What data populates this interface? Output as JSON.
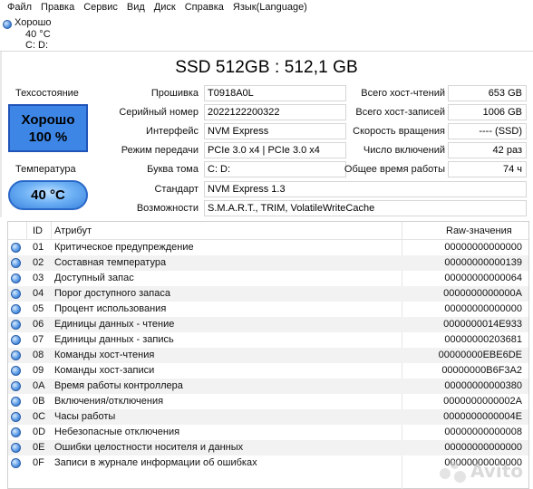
{
  "menu": [
    "Файл",
    "Правка",
    "Сервис",
    "Вид",
    "Диск",
    "Справка",
    "Язык(Language)"
  ],
  "drive_tab": {
    "status": "Хорошо",
    "temp": "40 °C",
    "letters": "C: D:"
  },
  "title": "SSD 512GB : 512,1 GB",
  "health": {
    "label": "Техсостояние",
    "status": "Хорошо",
    "percent": "100 %",
    "color": "#3d86e6"
  },
  "temperature": {
    "label": "Температура",
    "value": "40 °C"
  },
  "fields": {
    "firmware": {
      "label": "Прошивка",
      "value": "T0918A0L"
    },
    "serial": {
      "label": "Серийный номер",
      "value": "2022122200322"
    },
    "interface": {
      "label": "Интерфейс",
      "value": "NVM Express"
    },
    "transfer": {
      "label": "Режим передачи",
      "value": "PCIe 3.0 x4 | PCIe 3.0 x4"
    },
    "volume": {
      "label": "Буква тома",
      "value": "C: D:"
    },
    "standard": {
      "label": "Стандарт",
      "value": "NVM Express 1.3"
    },
    "features": {
      "label": "Возможности",
      "value": "S.M.A.R.T., TRIM, VolatileWriteCache"
    },
    "host_reads": {
      "label": "Всего хост-чтений",
      "value": "653 GB"
    },
    "host_writes": {
      "label": "Всего хост-записей",
      "value": "1006 GB"
    },
    "rotation": {
      "label": "Скорость вращения",
      "value": "---- (SSD)"
    },
    "power_count": {
      "label": "Число включений",
      "value": "42 раз"
    },
    "power_hours": {
      "label": "Общее время работы",
      "value": "74 ч"
    }
  },
  "table": {
    "headers": {
      "id": "ID",
      "attr": "Атрибут",
      "raw": "Raw-значения"
    },
    "rows": [
      {
        "id": "01",
        "attr": "Критическое предупреждение",
        "raw": "00000000000000"
      },
      {
        "id": "02",
        "attr": "Составная температура",
        "raw": "00000000000139"
      },
      {
        "id": "03",
        "attr": "Доступный запас",
        "raw": "00000000000064"
      },
      {
        "id": "04",
        "attr": "Порог доступного запаса",
        "raw": "0000000000000A"
      },
      {
        "id": "05",
        "attr": "Процент использования",
        "raw": "00000000000000"
      },
      {
        "id": "06",
        "attr": "Единицы данных - чтение",
        "raw": "0000000014E933"
      },
      {
        "id": "07",
        "attr": "Единицы данных - запись",
        "raw": "00000000203681"
      },
      {
        "id": "08",
        "attr": "Команды хост-чтения",
        "raw": "00000000EBE6DE"
      },
      {
        "id": "09",
        "attr": "Команды хост-записи",
        "raw": "00000000B6F3A2"
      },
      {
        "id": "0A",
        "attr": "Время работы контроллера",
        "raw": "00000000000380"
      },
      {
        "id": "0B",
        "attr": "Включения/отключения",
        "raw": "0000000000002A"
      },
      {
        "id": "0C",
        "attr": "Часы работы",
        "raw": "0000000000004E"
      },
      {
        "id": "0D",
        "attr": "Небезопасные отключения",
        "raw": "00000000000008"
      },
      {
        "id": "0E",
        "attr": "Ошибки целостности носителя и данных",
        "raw": "00000000000000"
      },
      {
        "id": "0F",
        "attr": "Записи в журнале информации об ошибках",
        "raw": "00000000000000"
      }
    ]
  },
  "watermark": "Avito"
}
